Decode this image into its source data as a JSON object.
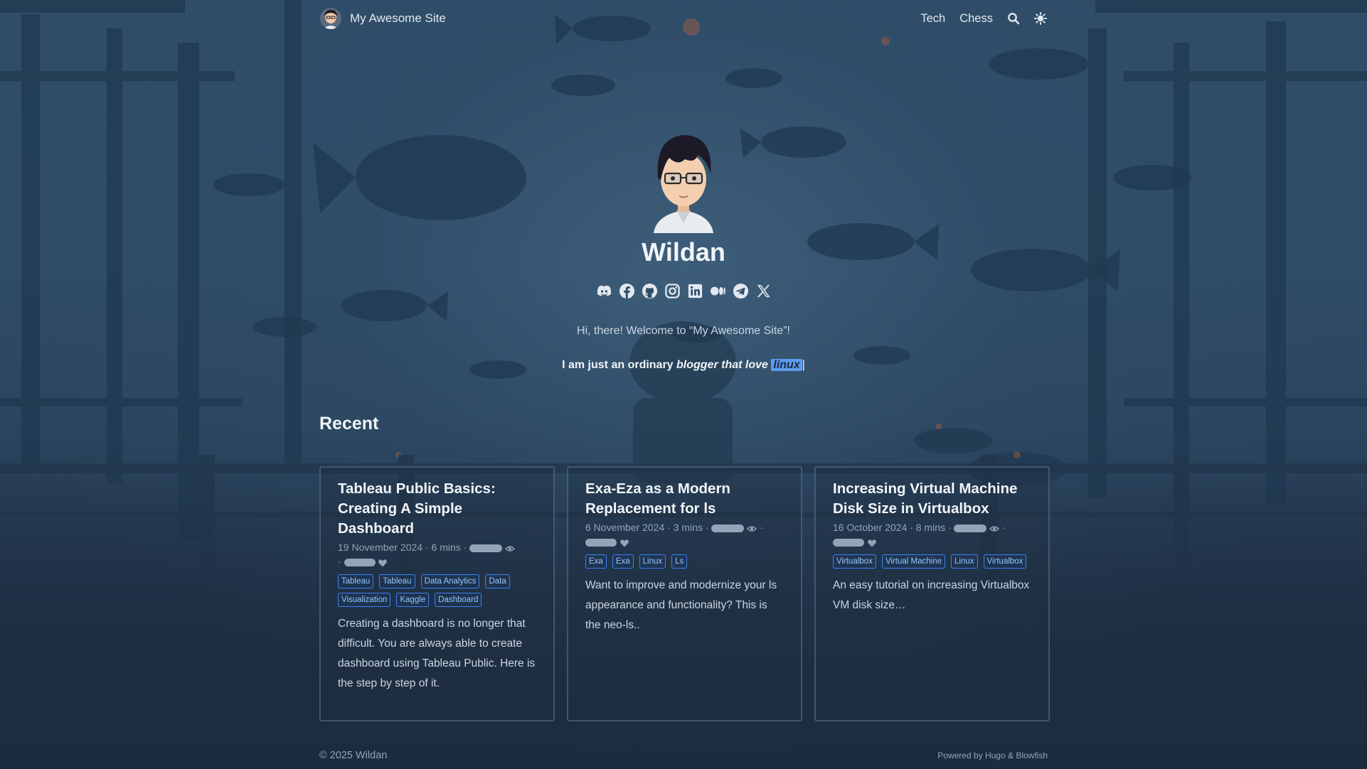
{
  "header": {
    "site_title": "My Awesome Site",
    "nav": [
      {
        "label": "Tech"
      },
      {
        "label": "Chess"
      }
    ],
    "search_icon": "search-icon",
    "theme_icon": "sun-icon"
  },
  "hero": {
    "name": "Wildan",
    "socials": [
      "discord-icon",
      "facebook-icon",
      "github-icon",
      "instagram-icon",
      "linkedin-icon",
      "medium-icon",
      "telegram-icon",
      "x-icon"
    ],
    "welcome": "Hi, there! Welcome to “My Awesome Site”!",
    "tagline_prefix": "I am just an ordinary",
    "tagline_em": "blogger that love",
    "tagline_highlight": "linux",
    "tagline_suffix": "|"
  },
  "recent": {
    "title": "Recent",
    "cards": [
      {
        "title": "Tableau Public Basics: Creating A Simple Dashboard",
        "date": "19 November 2024",
        "read_time": "6 mins",
        "tags": [
          "Tableau",
          "Tableau",
          "Data Analytics",
          "Data",
          "Visualization",
          "Kaggle",
          "Dashboard"
        ],
        "summary": "Creating a dashboard is no longer that difficult. You are always able to create dashboard using Tableau Public. Here is the step by step of it."
      },
      {
        "title": "Exa-Eza as a Modern Replacement for ls",
        "date": "6 November 2024",
        "read_time": "3 mins",
        "tags": [
          "Exa",
          "Exa",
          "Linux",
          "Ls"
        ],
        "summary": "Want to improve and modernize your ls appearance and functionality? This is the neo-ls.."
      },
      {
        "title": "Increasing Virtual Machine Disk Size in Virtualbox",
        "date": "16 October 2024",
        "read_time": "8 mins",
        "tags": [
          "Virtualbox",
          "Virtual Machine",
          "Linux",
          "Virtualbox"
        ],
        "summary": "An easy tutorial on increasing Virtualbox VM disk size…"
      }
    ]
  },
  "footer": {
    "copyright": "© 2025 Wildan",
    "powered": "Powered by Hugo & Blowfish"
  },
  "colors": {
    "accent": "#3b82f6",
    "highlight": "#5b9cf0",
    "background": "#2f4c66"
  }
}
